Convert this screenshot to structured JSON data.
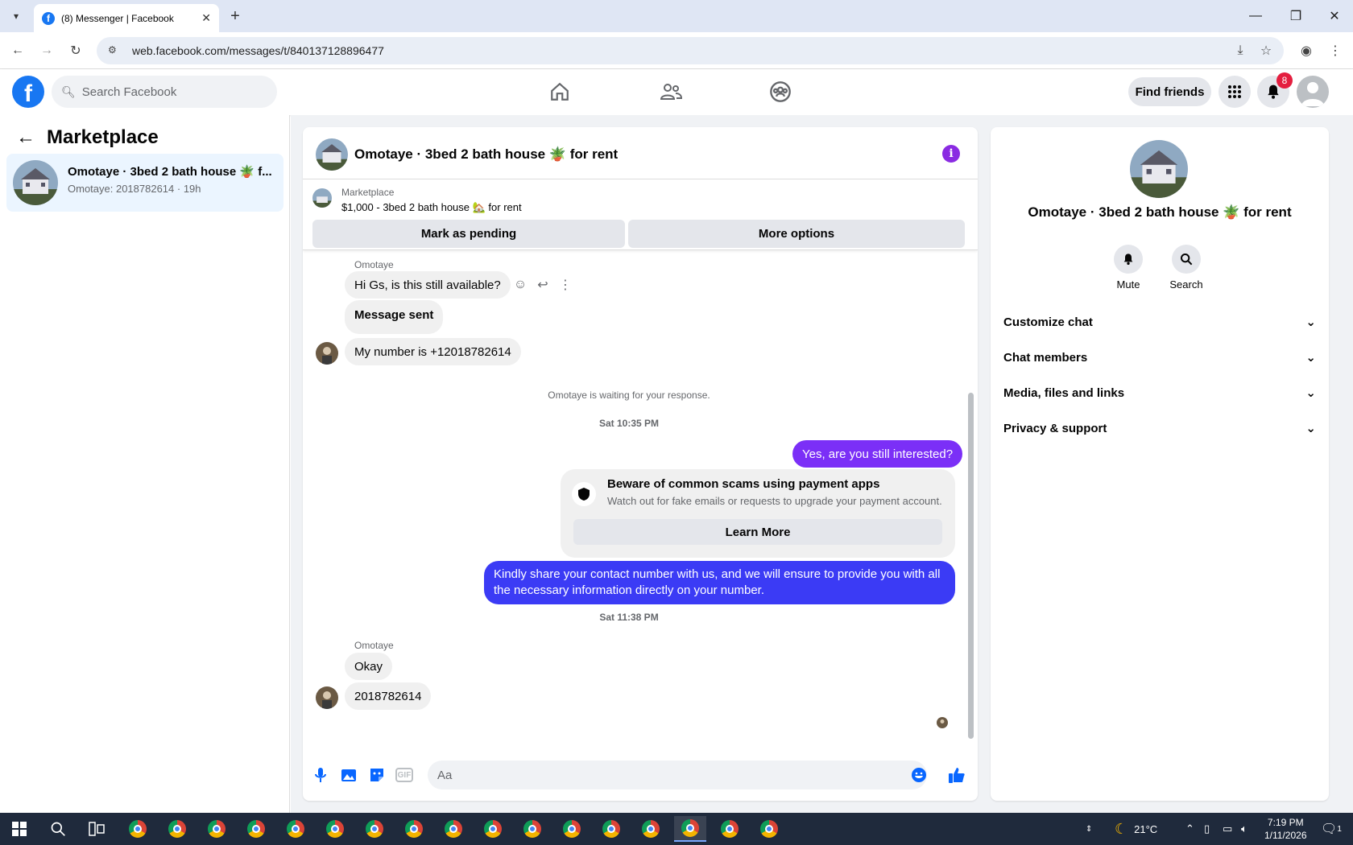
{
  "browser": {
    "tab_title": "(8) Messenger | Facebook",
    "url": "web.facebook.com/messages/t/840137128896477"
  },
  "fb": {
    "search_placeholder": "Search Facebook",
    "find_friends": "Find friends",
    "notif_count": "8"
  },
  "left": {
    "title": "Marketplace",
    "conv_name": "Omotaye · 3bed 2 bath house 🪴 f...",
    "conv_sub": "Omotaye: 2018782614 · 19h"
  },
  "chat": {
    "title": "Omotaye · 3bed 2 bath house 🪴 for rent",
    "banner_label": "Marketplace",
    "banner_price": "$1,000 - 3bed 2 bath house 🏡 for rent",
    "mark_pending": "Mark as pending",
    "more_options": "More options",
    "sender1": "Omotaye",
    "m1": "Hi Gs, is this still available?",
    "m2": "Message sent",
    "m3": "My number is +12018782614",
    "waiting": "Omotaye is waiting for your response.",
    "ts1": "Sat 10:35 PM",
    "out1": "Yes, are you still interested?",
    "scam_title": "Beware of common scams using payment apps",
    "scam_desc": "Watch out for fake emails or requests to upgrade your payment account.",
    "learn_more": "Learn More",
    "out2": "Kindly share your contact number with us, and we will ensure to provide you with all the necessary information directly on your number.",
    "ts2": "Sat 11:38 PM",
    "sender2": "Omotaye",
    "m4": "Okay",
    "m5": "2018782614",
    "composer_placeholder": "Aa"
  },
  "right": {
    "name": "Omotaye · 3bed 2 bath house 🪴 for rent",
    "mute": "Mute",
    "search": "Search",
    "rows": [
      "Customize chat",
      "Chat members",
      "Media, files and links",
      "Privacy & support"
    ]
  },
  "taskbar": {
    "temp": "21°C",
    "time": "7:19 PM",
    "date": "1/11/2026",
    "notif": "1"
  },
  "colors": {
    "accent": "#7b2ff7",
    "fb_blue": "#1877f2",
    "out_bubble_blue": "#3b3bf5"
  }
}
